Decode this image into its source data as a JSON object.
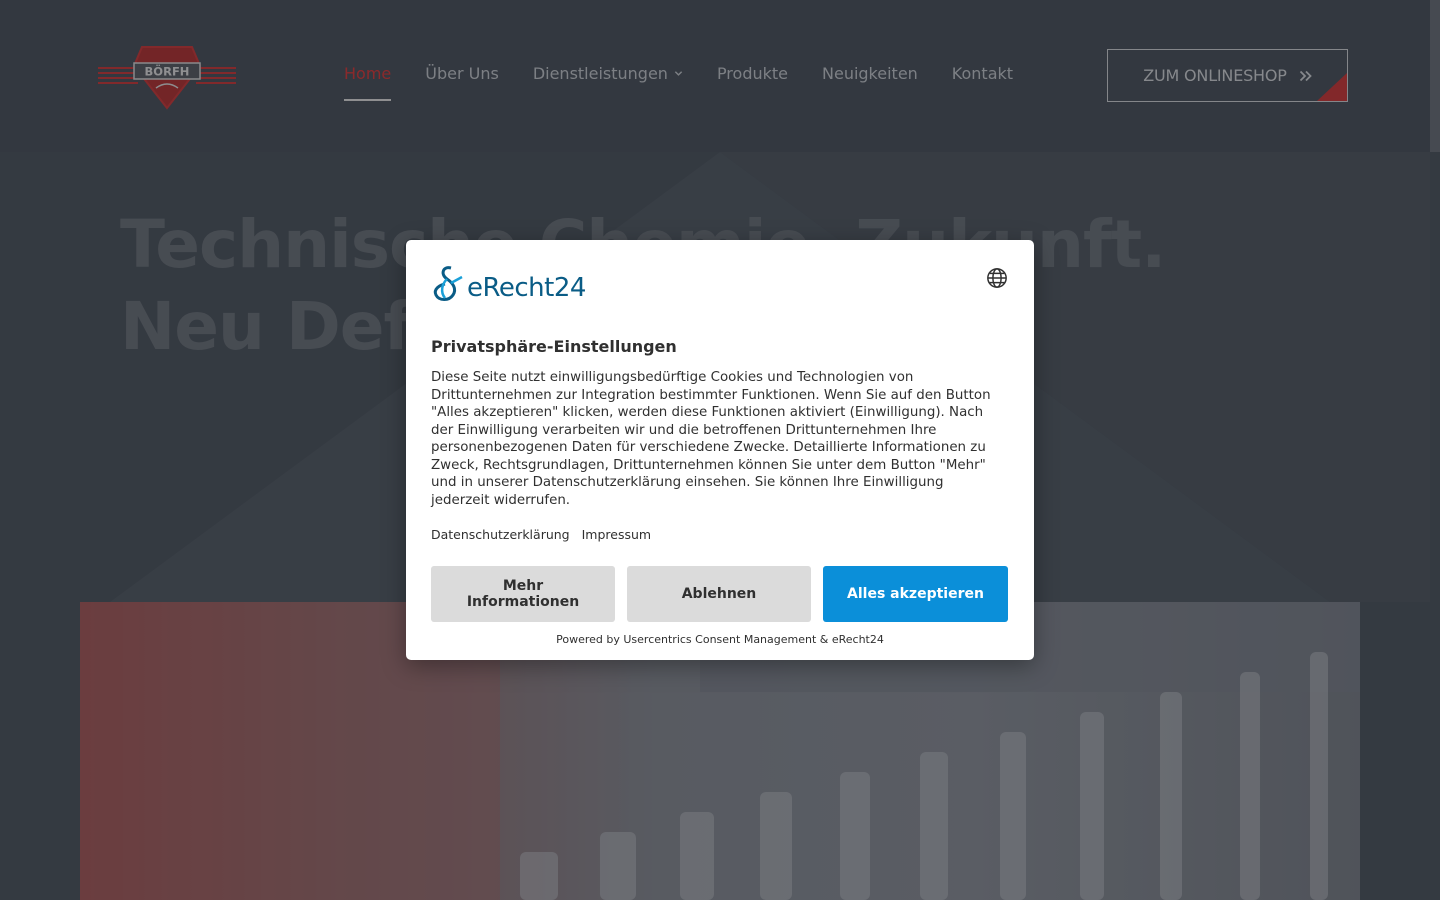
{
  "header": {
    "logo_text": "BÖRFH",
    "nav": [
      {
        "label": "Home",
        "active": true
      },
      {
        "label": "Über Uns",
        "active": false
      },
      {
        "label": "Dienstleistungen",
        "active": false,
        "has_dropdown": true
      },
      {
        "label": "Produkte",
        "active": false
      },
      {
        "label": "Neuigkeiten",
        "active": false
      },
      {
        "label": "Kontakt",
        "active": false
      }
    ],
    "shop_button": {
      "label": "ZUM ONLINESHOP",
      "icon": "double-chevron-right-icon"
    }
  },
  "hero": {
    "title": "Technische Chemie. Zukunft. Neu Definiert."
  },
  "consent_dialog": {
    "brand": "eRecht24",
    "language_icon": "globe-icon",
    "title": "Privatsphäre-Einstellungen",
    "text": "Diese Seite nutzt einwilligungsbedürftige Cookies und Technologien von Drittunternehmen zur Integration bestimmter Funktionen. Wenn Sie auf den Button \"Alles akzeptieren\" klicken, werden diese Funktionen aktiviert (Einwilligung). Nach der Einwilligung verarbeiten wir und die betroffenen Drittunternehmen Ihre personenbezogenen Daten für verschiedene Zwecke. Detaillierte Informationen zu Zweck, Rechtsgrundlagen, Drittunternehmen können Sie unter dem Button \"Mehr\" und in unserer Datenschutzerklärung einsehen. Sie können Ihre Einwilligung jederzeit widerrufen.",
    "links": [
      "Datenschutzerklärung",
      "Impressum"
    ],
    "buttons": {
      "more": "Mehr Informationen",
      "deny": "Ablehnen",
      "accept": "Alles akzeptieren"
    },
    "powered_by": "Powered by Usercentrics Consent Management & eRecht24"
  },
  "colors": {
    "accent_red": "#e23a3a",
    "accept_blue": "#0b8fd9",
    "brand_blue": "#0a5c86"
  }
}
